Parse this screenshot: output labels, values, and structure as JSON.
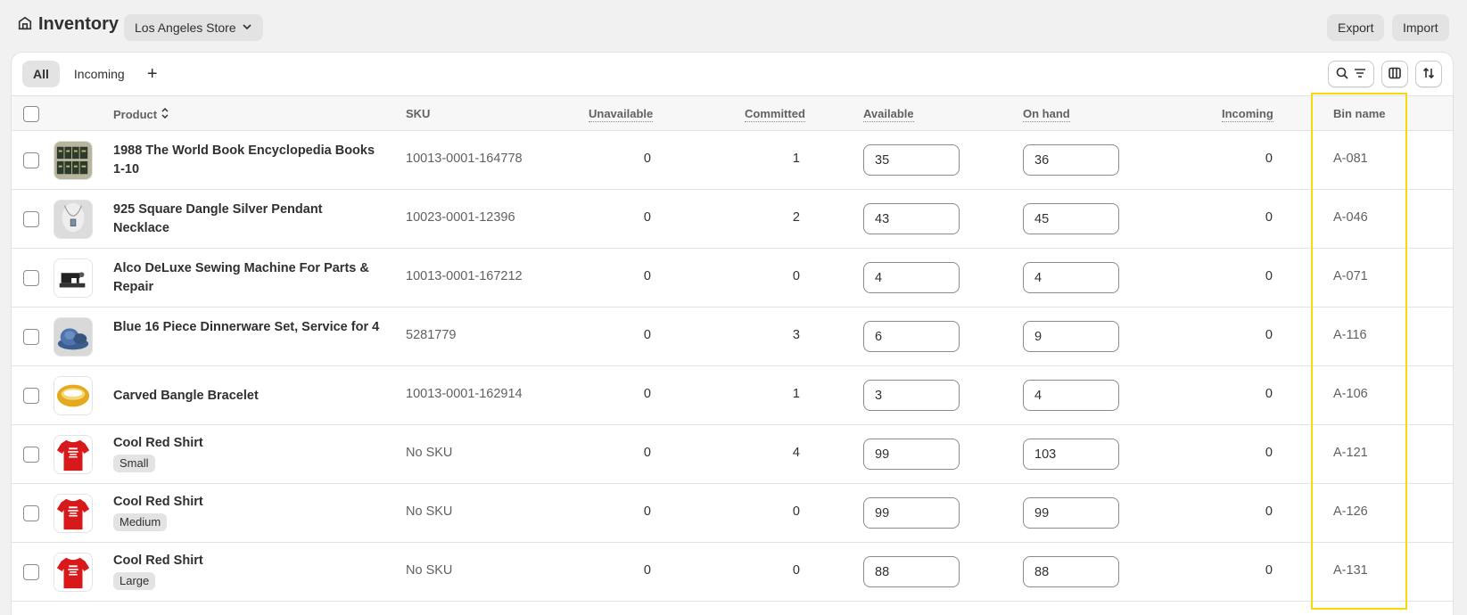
{
  "header": {
    "title": "Inventory",
    "store": "Los Angeles Store",
    "export_label": "Export",
    "import_label": "Import"
  },
  "tabs": [
    {
      "label": "All",
      "active": true
    },
    {
      "label": "Incoming",
      "active": false
    }
  ],
  "columns": {
    "product": "Product",
    "sku": "SKU",
    "unavailable": "Unavailable",
    "committed": "Committed",
    "available": "Available",
    "on_hand": "On hand",
    "incoming": "Incoming",
    "bin": "Bin name"
  },
  "rows": [
    {
      "name": "1988 The World Book Encyclopedia Books 1-10",
      "variant": "",
      "sku": "10013-0001-164778",
      "unavailable": "0",
      "committed": "1",
      "available": "35",
      "on_hand": "36",
      "incoming": "0",
      "bin": "A-081",
      "thumb": "books"
    },
    {
      "name": "925 Square Dangle Silver Pendant Necklace",
      "variant": "",
      "sku": "10023-0001-12396",
      "unavailable": "0",
      "committed": "2",
      "available": "43",
      "on_hand": "45",
      "incoming": "0",
      "bin": "A-046",
      "thumb": "necklace"
    },
    {
      "name": "Alco DeLuxe Sewing Machine For Parts & Repair",
      "variant": "",
      "sku": "10013-0001-167212",
      "unavailable": "0",
      "committed": "0",
      "available": "4",
      "on_hand": "4",
      "incoming": "0",
      "bin": "A-071",
      "thumb": "sewing"
    },
    {
      "name": "Blue 16 Piece Dinnerware Set, Service for 4",
      "variant": "",
      "sku": "5281779",
      "unavailable": "0",
      "committed": "3",
      "available": "6",
      "on_hand": "9",
      "incoming": "0",
      "bin": "A-116",
      "thumb": "dishes"
    },
    {
      "name": "Carved Bangle Bracelet",
      "variant": "",
      "sku": "10013-0001-162914",
      "unavailable": "0",
      "committed": "1",
      "available": "3",
      "on_hand": "4",
      "incoming": "0",
      "bin": "A-106",
      "thumb": "bangle"
    },
    {
      "name": "Cool Red Shirt",
      "variant": "Small",
      "sku": "No SKU",
      "unavailable": "0",
      "committed": "4",
      "available": "99",
      "on_hand": "103",
      "incoming": "0",
      "bin": "A-121",
      "thumb": "shirt"
    },
    {
      "name": "Cool Red Shirt",
      "variant": "Medium",
      "sku": "No SKU",
      "unavailable": "0",
      "committed": "0",
      "available": "99",
      "on_hand": "99",
      "incoming": "0",
      "bin": "A-126",
      "thumb": "shirt"
    },
    {
      "name": "Cool Red Shirt",
      "variant": "Large",
      "sku": "No SKU",
      "unavailable": "0",
      "committed": "0",
      "available": "88",
      "on_hand": "88",
      "incoming": "0",
      "bin": "A-131",
      "thumb": "shirt"
    }
  ],
  "icons": {
    "store": "store-icon",
    "chevron": "chevron-down-icon",
    "search_filter": "search-filter-icon",
    "columns": "columns-icon",
    "sort": "sort-icon"
  },
  "colors": {
    "highlight": "#f5d90a",
    "shirt_red": "#d7191c"
  }
}
